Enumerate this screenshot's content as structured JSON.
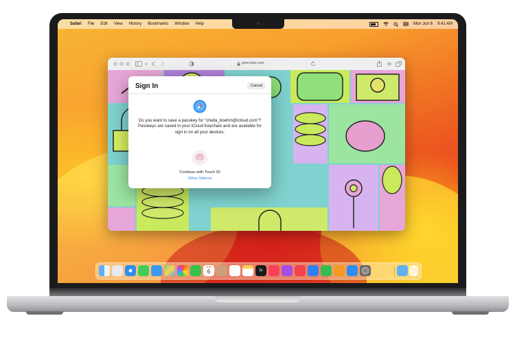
{
  "menubar": {
    "apple": "",
    "items": [
      "Safari",
      "File",
      "Edit",
      "View",
      "History",
      "Bookmarks",
      "Window",
      "Help"
    ],
    "date": "Mon Jun 6",
    "time": "9:41 AM"
  },
  "safari": {
    "url": "pinecurke.com"
  },
  "dialog": {
    "title": "Sign In",
    "cancel": "Cancel",
    "message": "Do you want to save a passkey for \"chella_boehm@icloud.com\"? Passkeys are saved in your iCloud Keychain and are available for sign in on all your devices.",
    "touch_label": "Continue with Touch ID",
    "other_options": "Other Options"
  },
  "dock": {
    "calendar_month": "JUN",
    "calendar_day": "6",
    "tv_label": "tv",
    "icons": [
      "finder-icon",
      "launchpad-icon",
      "safari-icon",
      "messages-icon",
      "mail-icon",
      "maps-icon",
      "photos-icon",
      "facetime-icon",
      "calendar-icon",
      "contacts-icon",
      "reminders-icon",
      "notes-icon",
      "apple-tv-icon",
      "music-icon",
      "podcasts-icon",
      "news-icon",
      "keynote-icon",
      "numbers-icon",
      "pages-icon",
      "app-store-icon",
      "system-preferences-icon",
      "downloads-folder-icon",
      "trash-icon"
    ]
  },
  "colors": {
    "accent_link": "#3a7fe0",
    "wallpaper_orange": "#f89f2e",
    "wallpaper_red": "#e8431f"
  }
}
